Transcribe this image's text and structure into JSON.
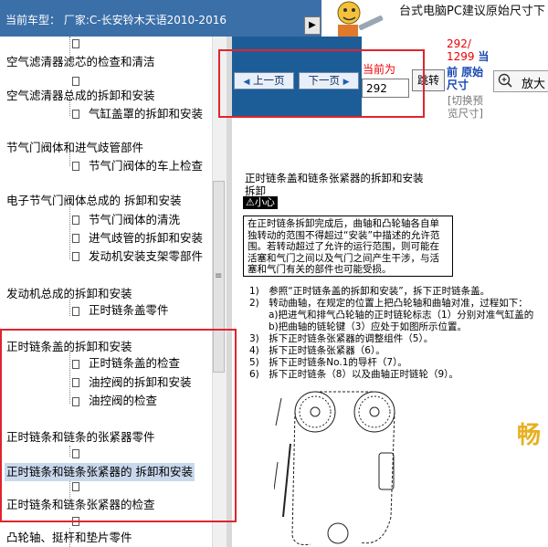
{
  "header": {
    "car_model": "当前车型：  厂家:C-长安铃木天语2010-2016",
    "collapse_arrow": "▶"
  },
  "ad": {
    "text": "台式电脑PC建议原始尺寸下"
  },
  "tree": {
    "items": [
      {
        "label": "空气滤清器滤芯的检查和清洁",
        "level": 0
      },
      {
        "label": "",
        "level": 1
      },
      {
        "label": "空气滤清器总成的拆卸和安装",
        "level": 0
      },
      {
        "label": "气缸盖罩的拆卸和安装",
        "level": 1
      },
      {
        "label": "节气门阀体和进气歧管部件",
        "level": 0
      },
      {
        "label": "节气门阀体的车上检查",
        "level": 1
      },
      {
        "label": "电子节气门阀体总成的 拆卸和安装",
        "level": 0
      },
      {
        "label": "节气门阀体的清洗",
        "level": 1
      },
      {
        "label": "进气歧管的拆卸和安装",
        "level": 1
      },
      {
        "label": "发动机安装支架零部件",
        "level": 1
      },
      {
        "label": "发动机总成的拆卸和安装",
        "level": 0
      },
      {
        "label": "正时链条盖零件",
        "level": 1
      },
      {
        "label": "正时链条盖的拆卸和安装",
        "level": 0
      },
      {
        "label": "正时链条盖的检查",
        "level": 1
      },
      {
        "label": "油控阀的拆卸和安装",
        "level": 1
      },
      {
        "label": "油控阀的检查",
        "level": 1
      },
      {
        "label": "正时链条和链条的张紧器零件",
        "level": 0
      },
      {
        "label": "正时链条和链条张紧器的 拆卸和安装",
        "level": 0,
        "selected": true
      },
      {
        "label": "正时链条和链条张紧器的检查",
        "level": 0
      },
      {
        "label": "凸轮轴、挺杆和垫片零件",
        "level": 0
      }
    ]
  },
  "pager": {
    "prev_label": "上一页",
    "next_label": "下一页",
    "current_label": "当前为",
    "current_page": "292",
    "jump_label": "跳转",
    "page_count": "292/\n1299",
    "page_count_suffix": "当",
    "orig_size_label": "前 原始尺寸",
    "preview_toggle": "[切换预览尺寸]",
    "zoom_label": "放大"
  },
  "document": {
    "title": "正时链条盖和链条张紧器的拆卸和安装",
    "subtitle": "拆卸",
    "caution": "⚠小心",
    "warning": "在正时链条拆卸完成后，曲轴和凸轮轴各自单独转动的范围不得超过“安装”中描述的允许范围。若转动超过了允许的运行范围，则可能在活塞和气门之间以及气门之间产生干涉，与活塞和气门有关的部件也可能受损。",
    "steps": [
      "1)　参照“正时链条盖的拆卸和安装”，拆下正时链条盖。",
      "2)　转动曲轴，在规定的位置上把凸轮轴和曲轴对准，过程如下：",
      "　　a)把进气和排气凸轮轴的正时链轮标志（1）分别对准气缸盖的",
      "　　b)把曲轴的链轮键（3）应处于如图所示位置。",
      "3)　拆下正时链条张紧器的调整组件（5）。",
      "4)　拆下正时链条张紧器（6）。",
      "5)　拆下正时链条No.1的导杆（7）。",
      "6)　拆下正时链条（8）以及曲轴正时链轮（9）。"
    ],
    "watermark": "畅"
  },
  "colors": {
    "header_bg": "#3b6fa8",
    "nav_blue": "#1d5d97",
    "highlight_red": "#e0242f",
    "page_count_red": "#ee0000",
    "orig_size_blue": "#1746b3",
    "watermark_orange": "#e8b020"
  }
}
